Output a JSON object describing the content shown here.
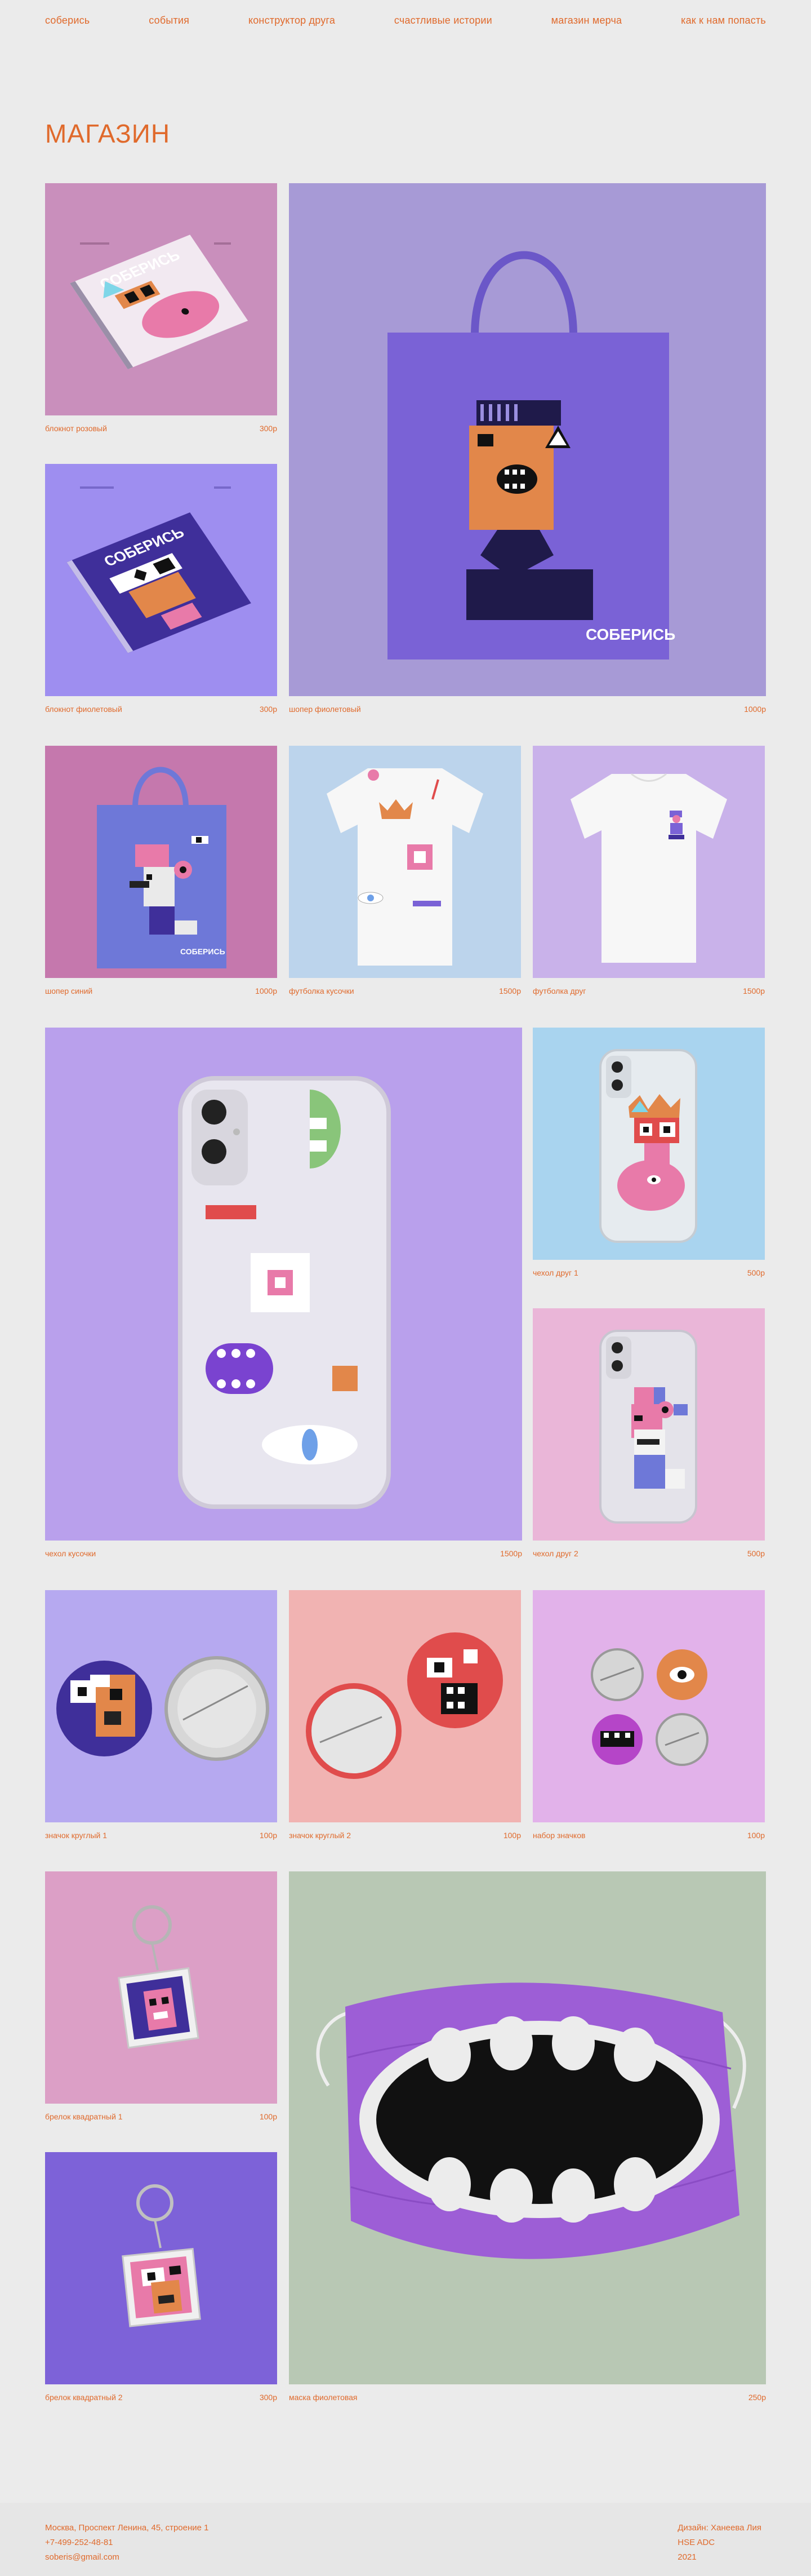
{
  "nav": {
    "items": [
      "соберись",
      "события",
      "конструктор друга",
      "счастливые истории",
      "магазин мерча",
      "как к нам попасть"
    ]
  },
  "page": {
    "title": "МАГАЗИН"
  },
  "products": [
    {
      "name": "блокнот розовый",
      "price": "300р",
      "bg": "#c98fbc",
      "icon": "notebook-pink-image"
    },
    {
      "name": "шопер фиолетовый",
      "price": "1000р",
      "bg": "#a79ad6",
      "icon": "tote-purple-image"
    },
    {
      "name": "блокнот фиолетовый",
      "price": "300р",
      "bg": "#9e8ef0",
      "icon": "notebook-violet-image"
    },
    {
      "name": "шопер синий",
      "price": "1000р",
      "bg": "#c578ad",
      "icon": "tote-blue-image"
    },
    {
      "name": "футболка кусочки",
      "price": "1500р",
      "bg": "#bcd4ec",
      "icon": "tshirt-pieces-image"
    },
    {
      "name": "футболка друг",
      "price": "1500р",
      "bg": "#c9b2ea",
      "icon": "tshirt-friend-image"
    },
    {
      "name": "чехол кусочки",
      "price": "1500р",
      "bg": "#b9a0ec",
      "icon": "phone-case-pieces-image"
    },
    {
      "name": "чехол друг 1",
      "price": "500р",
      "bg": "#a9d4ef",
      "icon": "phone-case-friend-1-image"
    },
    {
      "name": "чехол друг 2",
      "price": "500р",
      "bg": "#eab6d8",
      "icon": "phone-case-friend-2-image"
    },
    {
      "name": "значок круглый 1",
      "price": "100р",
      "bg": "#b6a9f0",
      "icon": "badge-round-1-image"
    },
    {
      "name": "значок круглый 2",
      "price": "100р",
      "bg": "#f1b3b2",
      "icon": "badge-round-2-image"
    },
    {
      "name": "набор значков",
      "price": "100р",
      "bg": "#e2b2ea",
      "icon": "badge-set-image"
    },
    {
      "name": "брелок квадратный 1",
      "price": "100р",
      "bg": "#dc9fc6",
      "icon": "keychain-1-image"
    },
    {
      "name": "маска фиолетовая",
      "price": "250р",
      "bg": "#b8c8b4",
      "icon": "mask-purple-image"
    },
    {
      "name": "брелок квадратный 2",
      "price": "300р",
      "bg": "#7d62d8",
      "icon": "keychain-2-image"
    }
  ],
  "brand": {
    "wordmark": "СОБЕРИСЬ"
  },
  "footer": {
    "address": "Москва, Проспект Ленина, 45, строение 1",
    "phone": "+7-499-252-48-81",
    "email": "soberis@gmail.com",
    "credit": "Дизайн: Ханеева Лия",
    "school": "HSE ADC",
    "year": "2021"
  },
  "colors": {
    "accent": "#e06a2c",
    "page_bg": "#ebebeb",
    "face_orange": "#e2874a",
    "deep_purple": "#3f2f9a",
    "pink_face": "#e87aa9"
  }
}
